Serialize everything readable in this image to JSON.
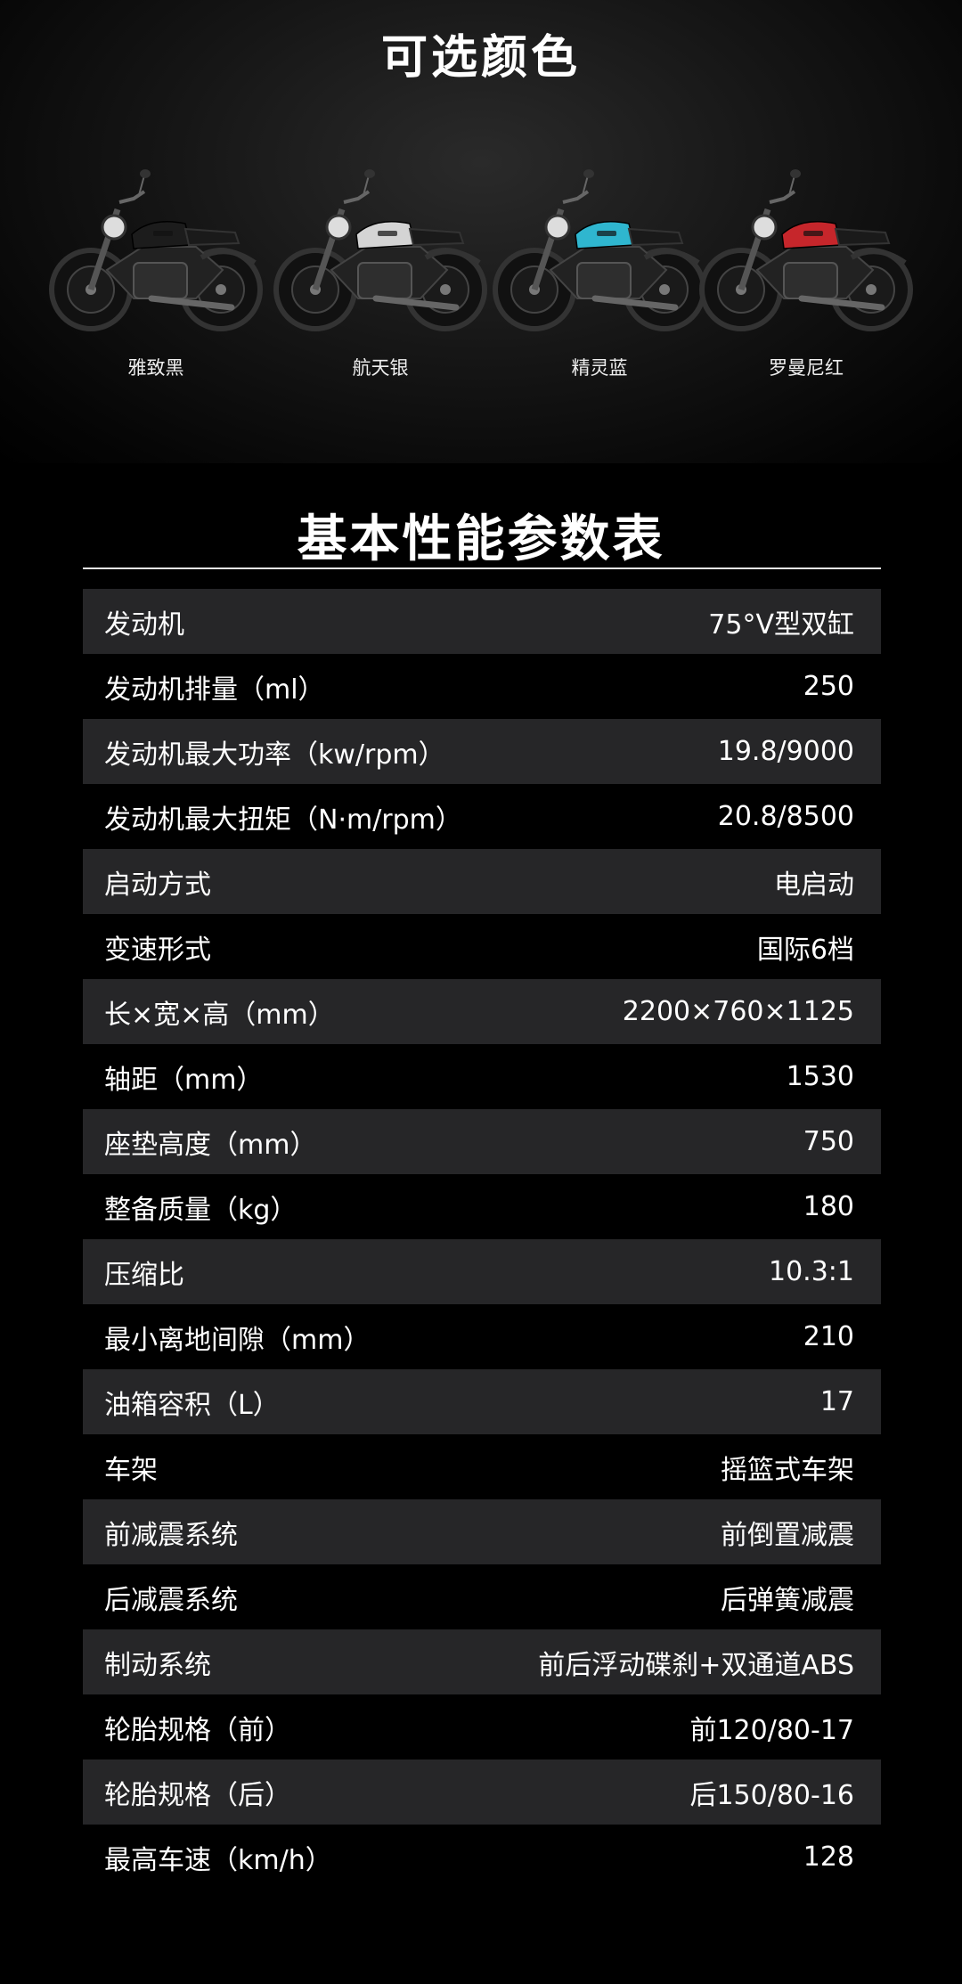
{
  "colors_section": {
    "title": "可选颜色",
    "variants": [
      {
        "label": "雅致黑",
        "tank_color": "#1c1c1c"
      },
      {
        "label": "航天银",
        "tank_color": "#d4d4d4"
      },
      {
        "label": "精灵蓝",
        "tank_color": "#2fb6cf"
      },
      {
        "label": "罗曼尼红",
        "tank_color": "#c6262b"
      }
    ]
  },
  "spec_section": {
    "title": "基本性能参数表",
    "rows": [
      {
        "label": "发动机",
        "value": "75°V型双缸"
      },
      {
        "label": "发动机排量（ml）",
        "value": "250"
      },
      {
        "label": "发动机最大功率（kw/rpm）",
        "value": "19.8/9000"
      },
      {
        "label": "发动机最大扭矩（N·m/rpm）",
        "value": "20.8/8500"
      },
      {
        "label": "启动方式",
        "value": "电启动"
      },
      {
        "label": "变速形式",
        "value": "国际6档"
      },
      {
        "label": "长×宽×高（mm）",
        "value": "2200×760×1125"
      },
      {
        "label": "轴距（mm）",
        "value": "1530"
      },
      {
        "label": "座垫高度（mm）",
        "value": "750"
      },
      {
        "label": "整备质量（kg）",
        "value": "180"
      },
      {
        "label": "压缩比",
        "value": "10.3:1"
      },
      {
        "label": "最小离地间隙（mm）",
        "value": "210"
      },
      {
        "label": "油箱容积（L）",
        "value": "17"
      },
      {
        "label": "车架",
        "value": "摇篮式车架"
      },
      {
        "label": "前减震系统",
        "value": "前倒置减震"
      },
      {
        "label": "后减震系统",
        "value": "后弹簧减震"
      },
      {
        "label": "制动系统",
        "value": "前后浮动碟刹+双通道ABS"
      },
      {
        "label": "轮胎规格（前）",
        "value": "前120/80-17"
      },
      {
        "label": "轮胎规格（后）",
        "value": "后150/80-16"
      },
      {
        "label": "最高车速（km/h）",
        "value": "128"
      }
    ]
  }
}
